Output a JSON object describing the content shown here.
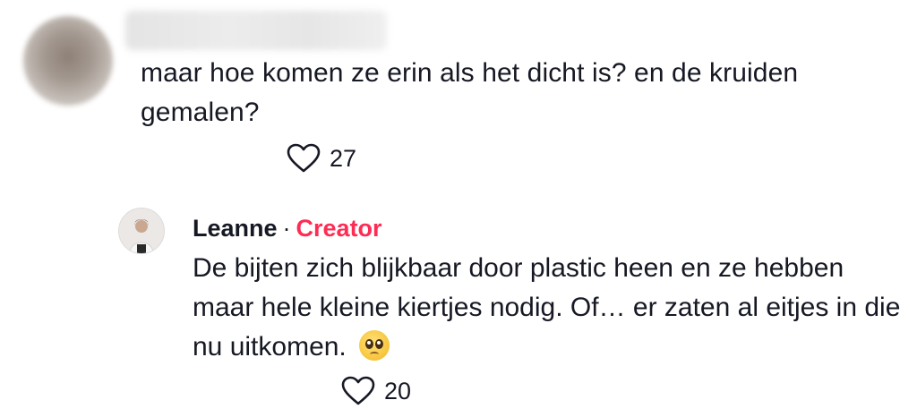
{
  "comment": {
    "author_name": "",
    "text": "maar hoe komen ze erin als het dicht is? en de kruiden gemalen?",
    "likes": "27"
  },
  "reply": {
    "author_name": "Leanne",
    "separator": "·",
    "badge": "Creator",
    "text": "De bijten zich blijkbaar door plastic heen en ze hebben maar hele kleine kiertjes nodig. Of… er zaten al eitjes in die nu uitkomen.",
    "emoji": "pleading-face",
    "likes": "20"
  },
  "icons": {
    "like": "heart-outline-icon"
  },
  "colors": {
    "creator_badge": "#fe2c55",
    "text": "#161823"
  }
}
